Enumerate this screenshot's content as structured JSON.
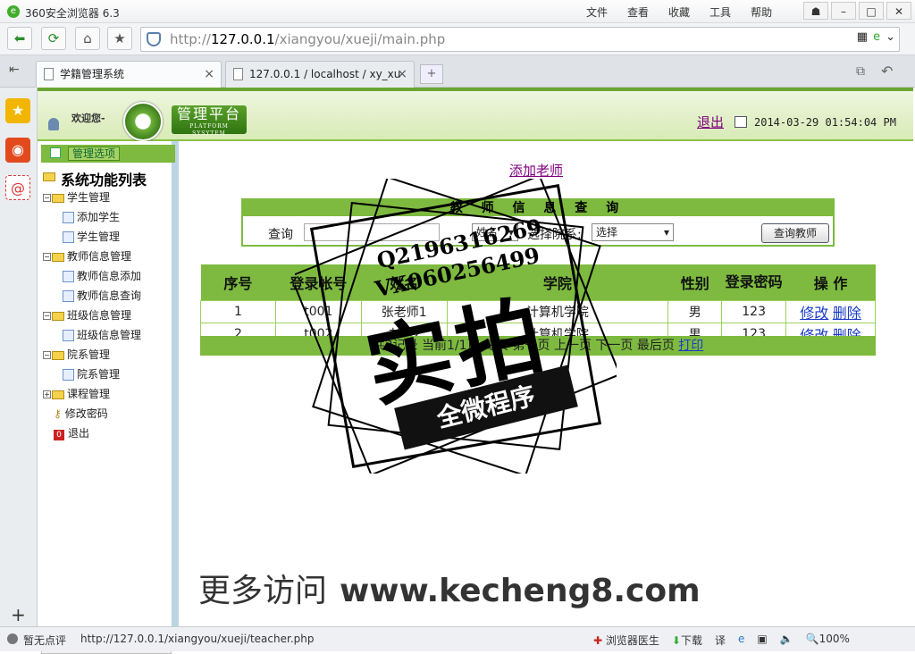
{
  "browser": {
    "title": "360安全浏览器 6.3",
    "menus": [
      "文件",
      "查看",
      "收藏",
      "工具",
      "帮助"
    ],
    "url_host": "127.0.0.1",
    "url_path": "/xiangyou/xueji/main.php",
    "tabs": [
      {
        "label": "学籍管理系统"
      },
      {
        "label": "127.0.0.1 / localhost / xy_xu"
      }
    ],
    "status_review": "暂无点评",
    "status_url": "http://127.0.0.1/xiangyou/xueji/teacher.php",
    "status_right": [
      "浏览器医生",
      "下载",
      "100%"
    ]
  },
  "header": {
    "welcome": "欢迎您-",
    "platform": "管理平台",
    "platform_en": "PLATFORM SYSYTEM",
    "logout": "退出",
    "datetime": "2014-03-29 01:54:04 PM"
  },
  "sidebar": {
    "options_label": "管理选项",
    "root": "系统功能列表",
    "nodes": [
      {
        "label": "学生管理",
        "type": "folder"
      },
      {
        "label": "添加学生",
        "type": "leaf"
      },
      {
        "label": "学生管理",
        "type": "leaf"
      },
      {
        "label": "教师信息管理",
        "type": "folder"
      },
      {
        "label": "教师信息添加",
        "type": "leaf"
      },
      {
        "label": "教师信息查询",
        "type": "leaf"
      },
      {
        "label": "班级信息管理",
        "type": "folder"
      },
      {
        "label": "班级信息管理",
        "type": "leaf"
      },
      {
        "label": "院系管理",
        "type": "folder"
      },
      {
        "label": "院系管理",
        "type": "leaf"
      },
      {
        "label": "课程管理",
        "type": "folder"
      },
      {
        "label": "修改密码",
        "type": "item"
      },
      {
        "label": "退出",
        "type": "item"
      }
    ]
  },
  "main": {
    "add_teacher": "添加老师",
    "search": {
      "title": "教 师 信 息 查 询",
      "query_label": "查询",
      "field_select": "姓名",
      "college_label": "选择院系:",
      "college_select": "选择",
      "button": "查询教师"
    },
    "table": {
      "headers": [
        "序号",
        "登录帐号",
        "姓名",
        "学院",
        "性别",
        "登录密码",
        "操 作"
      ],
      "rows": [
        [
          "1",
          "t001",
          "张老师1",
          "计算机学院",
          "男",
          "123"
        ],
        [
          "2",
          "t002",
          "老师2",
          "计算机学院",
          "男",
          "123"
        ]
      ],
      "edit": "修改",
      "delete": "删除"
    },
    "pager": {
      "text": "共2记录 当前1/1页 每页 第一页 上一页 下一页 最后页",
      "print": "打印"
    }
  },
  "watermark": {
    "qq": "Q2196316269",
    "vx": "VX060256499",
    "big": "实拍",
    "ribbon": "全微程序",
    "footer_cn": "更多访问",
    "footer_en": "www.kecheng8.com"
  }
}
